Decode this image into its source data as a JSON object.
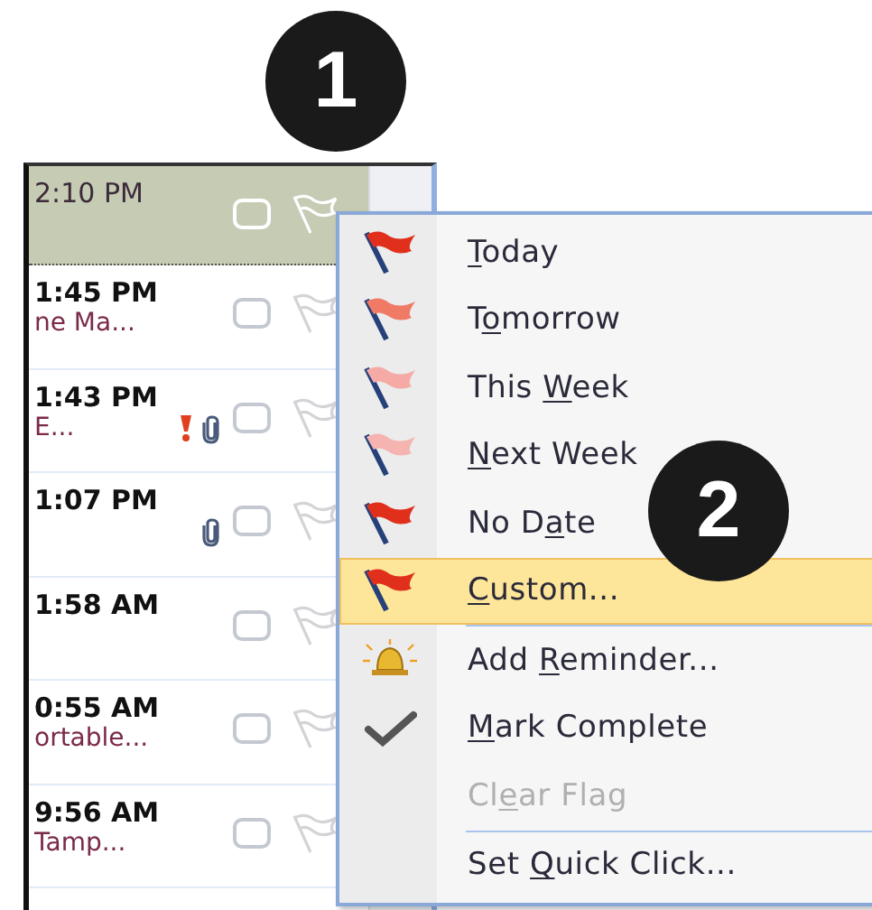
{
  "callouts": [
    {
      "label": "1"
    },
    {
      "label": "2"
    }
  ],
  "messages": [
    {
      "time": "2:10 PM",
      "important": false,
      "attachment": false,
      "selected": true
    },
    {
      "time": "1:45 PM",
      "subject": "ne Ma...",
      "important": false,
      "attachment": false,
      "selected": false
    },
    {
      "time": "1:43 PM",
      "subject": "E...",
      "important": true,
      "attachment": true,
      "selected": false
    },
    {
      "time": "1:07 PM",
      "important": false,
      "attachment": true,
      "selected": false
    },
    {
      "time": "1:58 AM",
      "important": false,
      "attachment": false,
      "selected": false
    },
    {
      "time": "0:55 AM",
      "subject": "ortable...",
      "important": false,
      "attachment": false,
      "selected": false
    },
    {
      "time": "9:56 AM",
      "subject": "Tamp...",
      "important": false,
      "attachment": false,
      "selected": false
    }
  ],
  "menu": [
    {
      "kind": "flag",
      "color": "#e0301c",
      "key": "T",
      "after": "oday",
      "selected": false,
      "disabled": false
    },
    {
      "kind": "flag",
      "color": "#f07a66",
      "before": "T",
      "key": "o",
      "after": "morrow",
      "selected": false,
      "disabled": false
    },
    {
      "kind": "flag",
      "color": "#f5aaa6",
      "before": "This ",
      "key": "W",
      "after": "eek",
      "selected": false,
      "disabled": false
    },
    {
      "kind": "flag",
      "color": "#f5b4b0",
      "key": "N",
      "after": "ext Week",
      "selected": false,
      "disabled": false
    },
    {
      "kind": "flag",
      "color": "#e0301c",
      "before": "No D",
      "key": "a",
      "after": "te",
      "selected": false,
      "disabled": false
    },
    {
      "kind": "flag",
      "color": "#e0301c",
      "key": "C",
      "after": "ustom...",
      "selected": true,
      "disabled": false
    },
    {
      "kind": "separator"
    },
    {
      "kind": "bell",
      "before": "Add ",
      "key": "R",
      "after": "eminder...",
      "selected": false,
      "disabled": false
    },
    {
      "kind": "check",
      "key": "M",
      "after": "ark Complete",
      "selected": false,
      "disabled": false
    },
    {
      "kind": "plain",
      "before": "Cl",
      "key": "e",
      "after": "ar Flag",
      "selected": false,
      "disabled": true
    },
    {
      "kind": "separator"
    },
    {
      "kind": "plain",
      "before": "Set ",
      "key": "Q",
      "after": "uick Click...",
      "selected": false,
      "disabled": false
    }
  ]
}
